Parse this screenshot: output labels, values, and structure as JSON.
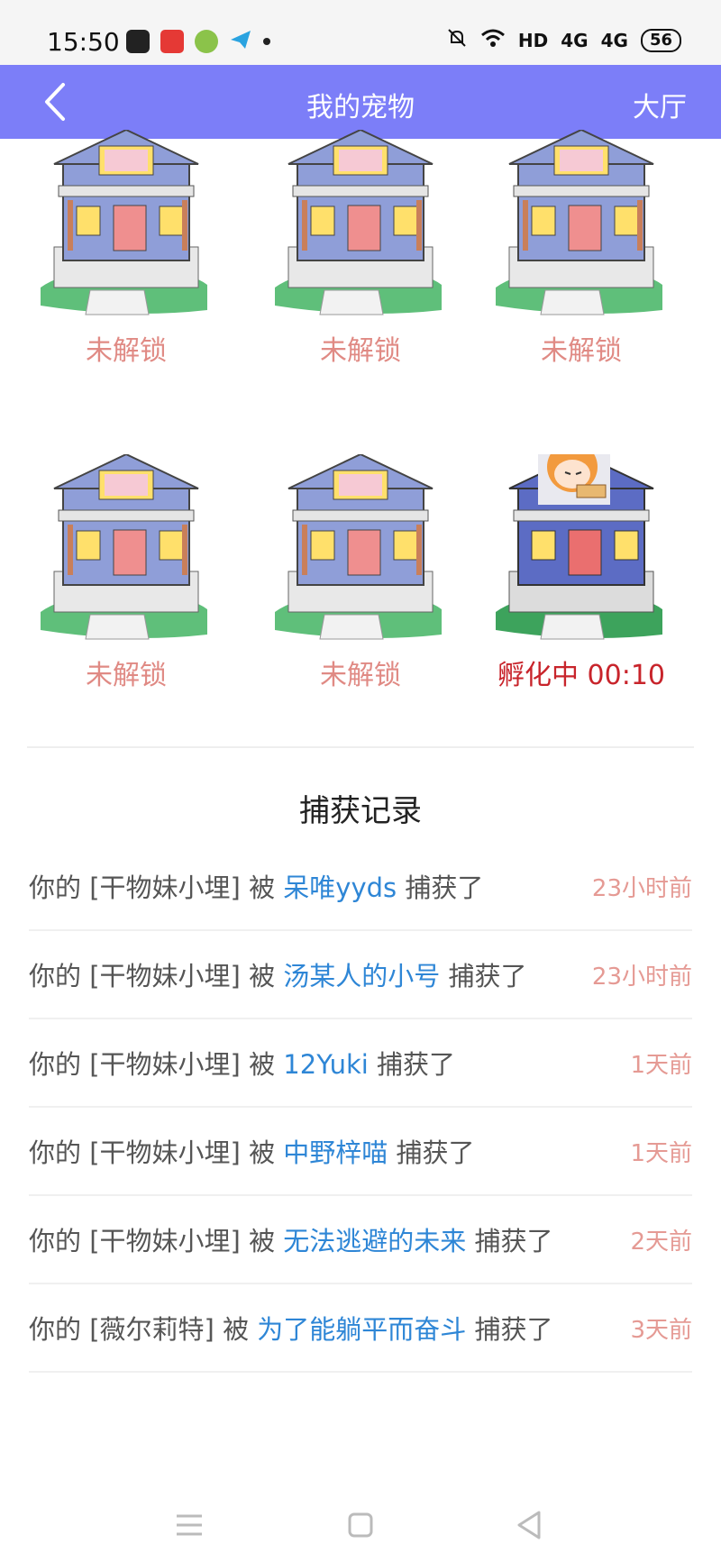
{
  "status_bar": {
    "time": "15:50",
    "network": "HD",
    "signal1": "4G",
    "signal2": "4G",
    "battery": "56",
    "icons": [
      "baidu-app-icon",
      "app2-icon",
      "app3-icon",
      "telegram-icon",
      "notification-dot",
      "mute-icon",
      "wifi-icon"
    ]
  },
  "header": {
    "title": "我的宠物",
    "back_icon": "chevron-left-icon",
    "right_label": "大厅",
    "color": "#7c7ef8"
  },
  "pets": [
    {
      "label": "未解锁",
      "status": "locked",
      "icon": "house-icon"
    },
    {
      "label": "未解锁",
      "status": "locked",
      "icon": "house-icon"
    },
    {
      "label": "未解锁",
      "status": "locked",
      "icon": "house-icon"
    },
    {
      "label": "未解锁",
      "status": "locked",
      "icon": "house-icon"
    },
    {
      "label": "未解锁",
      "status": "locked",
      "icon": "house-icon"
    },
    {
      "label": "孵化中 00:10",
      "status": "hatching",
      "icon": "house-with-character-icon"
    }
  ],
  "records": {
    "title": "捕获记录",
    "items": [
      {
        "prefix": "你的 [干物妹小埋] 被 ",
        "user": "呆唯yyds",
        "suffix": " 捕获了",
        "time": "23小时前"
      },
      {
        "prefix": "你的 [干物妹小埋] 被 ",
        "user": "汤某人的小号",
        "suffix": " 捕获了",
        "time": "23小时前"
      },
      {
        "prefix": "你的 [干物妹小埋] 被 ",
        "user": "12Yuki",
        "suffix": " 捕获了",
        "time": "1天前"
      },
      {
        "prefix": "你的 [干物妹小埋] 被 ",
        "user": "中野梓喵",
        "suffix": " 捕获了",
        "time": "1天前"
      },
      {
        "prefix": "你的 [干物妹小埋] 被 ",
        "user": "无法逃避的未来",
        "suffix": " 捕获了",
        "time": "2天前"
      },
      {
        "prefix": "你的 [薇尔莉特] 被 ",
        "user": "为了能躺平而奋斗",
        "suffix": " 捕获了",
        "time": "3天前"
      }
    ]
  },
  "system_nav": [
    "menu-icon",
    "home-icon",
    "back-triangle-icon"
  ]
}
